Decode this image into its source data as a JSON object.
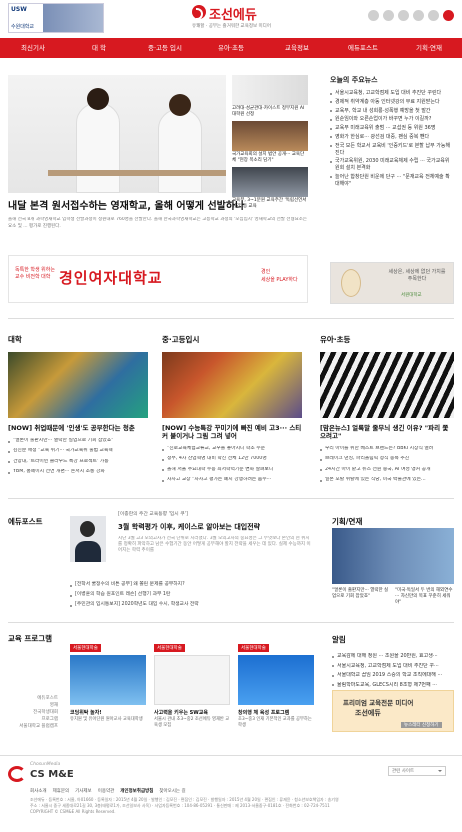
{
  "header": {
    "usw_logo": "USW",
    "usw_sub": "수원대학교",
    "brand_name": "조선에듀",
    "brand_tagline": "유쾌할 · 공부는 즐거워한 교육정보 미디어"
  },
  "nav": [
    "최신기사",
    "대 학",
    "중·고등 입시",
    "유아·초등",
    "교육정보",
    "에듀포스트",
    "기획·연재"
  ],
  "hero": {
    "title": "내달 본격 원서접수하는 영재학교, 올해 어떻게 선발하나",
    "desc": "올해 전국 8개 과학영재학교 입학생 선발과정이 정원내로 760명을 선발한다. 올해 한국과학영재학교는 고등학교 과정의 '모집입시' 영재학교의 선발 전형요소는 요소 및 ... 평가로 진행된다."
  },
  "side_thumbs": [
    {
      "caption": "고려대·성균관대·카이스트 정부지원 AI 대학원 선정"
    },
    {
      "caption": "국가교육회의 설치 법안 공개··· 교육단체 \"현장 목소리 담기\""
    },
    {
      "caption": "교육부, 3~1분원 교육주간 '독립선언서 읽기' 등 교육"
    }
  ],
  "ad_top": {
    "small": "독특한 학생 위하는 교수 비전학 대학",
    "big": "경인여자대학교",
    "right1": "경인",
    "right2": "세상을 PLAY하다"
  },
  "headlines": {
    "title": "오늘의 주요뉴스",
    "items": [
      "서울시교육청, 고교학점제 도입 대비 추진단 꾸린다",
      "경제적 취약계층 아동 인터넷강의 무료 지원받는다",
      "교육부, 학교 내 성희롱·성폭행 예방을 첫 발간",
      "원순임이와 오른손업이가 바꾸면 누가 이길까?",
      "교육부 미래교육위 출범 ··· 교섭권 등 위원 36명",
      "영화가 한심로··· 광선검 대중, 팬심 중복 뺀다",
      "전국 모든 학교서 교육비 '인증키드'로 본할 납부 가능해진다",
      "국가교육위원, 2030 미래교육체제 수립 ··· 국가교육위원회 설치 본격화",
      "늘어난 합창단원 비운에 단구 ··· \"문재교육 전체예술 확대해야\""
    ]
  },
  "ad_right": {
    "text": "세상은, 세상에 없던 가치를 주목한다",
    "logo": "서원대학교"
  },
  "sections": {
    "univ": {
      "label": "대학",
      "title": "[NOW] 취업때문에 '인생'도 공부한다는 청춘",
      "items": [
        "\"얼론이 출판지만··· 열락한 실업으로 기회 잡았죠\"",
        "김진분 애정 \"교육 위기··· 국가교육위 출범 교육혁",
        "건양대, '트라이빈 클라우드 특강 프로젝트' 가동",
        "YBM, 홈페이지 전면 개편··· 논서지 소통 강화"
      ]
    },
    "mid": {
      "label": "중·고등입시",
      "title": "[NOW] 수능특강 꾸미기에 빠진 예비 고3··· 스티커 붙이거나 그림 그려 넣어",
      "items": [
        "\"진로교육체험교류교, 교우들 놓아지니 학소 수준",
        "정부, 4차 산업혁명 대비 학신 전체 12만 7000명",
        "올해 서울 주요대학 수능 최저학력기준 변화 살펴보니",
        "자사고 교장 \"자사고 평가는 폐지 강행하려는 움수···"
      ]
    },
    "kid": {
      "label": "유아·초등",
      "title": "[맘은뉴스] 얼룩말 줄무늬 생긴 이유? \"파리 쫓으려고\"",
      "items": [
        "우리 아이를 위한 베스트 브랜드는? BBKI 시상식 열려",
        "브레이크 댄싱, 파리올림픽 정식 종목 추진",
        "24시간 아이 맡고 뉴스 전원 중국, AI 여성 앵커 공개",
        "일본 포탈 위탈에 있는 식당, 미국 박물관에 있는..."
      ]
    },
    "edupost": {
      "label": "에듀포스트",
      "writer": "[이종란의 주간 교육동향 '입시 쿠']",
      "title": "3월 학력평가 이후, 케이스로 알아보는 대입전략",
      "desc": "지난 3월 고3 모의고사가 전국 단위로 치러졌다. 3월 모의고사의 중요성은 그 무엇보다 본인의 현 위치를 정확히 파악하고 남은 수험기간 동안 어떻게 공부해야 할지 전략을 세우는 데 있다. 실제 수능까지 이어지는 학력 추이를",
      "items": [
        "[전학서 쿨정수의 비튼 공부] 왜 쫄린 문제를 공부하지?",
        "[이병훈의 학습 원포인트 레슨] 선행기 과부 1탄",
        "[주민관의 입시통보지] 2020학년도 대입 수시, 학생교사 전략"
      ]
    },
    "planning": {
      "label": "기획/연재",
      "cap1": "\"얼론이 출판지만··· 열락한 실업으로 기회 잡았죠\"",
      "cap2": "\"미국·독일서 두 번의 해외연수··· 자신만의 목표 꾸준히 세워야\""
    },
    "program": {
      "label": "교육 프로그램",
      "side": [
        "에듀포스트",
        "영재",
        "전국학생대회",
        "프로그램",
        "서울대학교 플럼캠프"
      ],
      "cards": [
        {
          "badge": "서울현대학술",
          "title": "코딩위탁 놀자!",
          "desc": "유치원 및 유아단원 원아교사 교육대학생"
        },
        {
          "badge": "서울현대학술",
          "title": "사고력을 키우는 SW교육",
          "desc": "서울시 관내 초3~중2 조선에듀 영재반 교육생 모집"
        },
        {
          "badge": "서울현대학술",
          "title": "창의행 체 육성 프로그램",
          "desc": "초3~중3 인재 기본적인 교과를 공부하는 학생"
        }
      ]
    },
    "notice": {
      "label": "알림",
      "items": [
        "교육감에 대해 청원 ··· 조원을 20만원, 효고생···",
        "서울시교육청, 고교학점제 도입 대비 추진단 꾸···",
        "서울대학교 꼽임 2019 스승의 학교 조직에대해 ···",
        "율림학마도교육, GLECS시리 8조형 제7번째 ···"
      ]
    },
    "ad_bottom": {
      "a": "프리미엄 교육전문 미디어",
      "b": "조선에듀",
      "c": "뉴스레터 신청하기"
    }
  },
  "footer": {
    "brand_small": "ChosunMedia",
    "brand": "CS M&E",
    "select": "관련 사이트",
    "links": [
      "회사소개",
      "제휴문의",
      "기사제보",
      "이용약관",
      "개인정보취급방침",
      "찾아오시는 길"
    ],
    "info": [
      "조선에듀 · 등록번호 : 서울, 아01660 · 등록일자 : 2015년 4월 20일 · 발행인 : 김모진 · 편집인 : 김모진 · 발행일자 : 2015년 4월 20일 · 편집인 : 류재윤 · 청소년보호책임자 : 송기영",
      "주소 : 서울시 중구 세종대로21길 30, 3층(태평로1가, 조선일보사 사옥) · 사업자등록번호 : 104-86-05291 · 통신판매 : 제 2013-서울중구-0181호 · 전화번호 : 02-724-7511",
      "COPYRIGHT © CSM&E All Rights Reserved."
    ]
  },
  "colors": {
    "brand": "#d71920"
  }
}
